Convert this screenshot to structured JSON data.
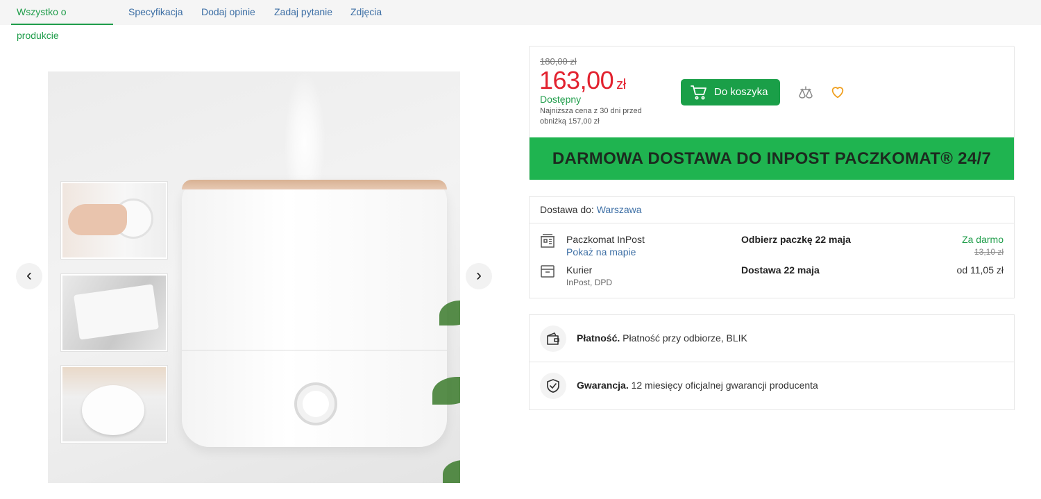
{
  "tabs": [
    {
      "label": "Wszystko o produkcie"
    },
    {
      "label": "Specyfikacja"
    },
    {
      "label": "Dodaj opinie"
    },
    {
      "label": "Zadaj pytanie"
    },
    {
      "label": "Zdjęcia"
    }
  ],
  "gallery": {
    "prev_symbol": "‹",
    "next_symbol": "›"
  },
  "pricing": {
    "old_price": "180,00 zł",
    "price": "163,00",
    "currency": "zł",
    "availability": "Dostępny",
    "lowest_price_note": "Najniższa cena z 30 dni przed obniżką 157,00 zł",
    "add_to_cart": "Do koszyka",
    "banner": "DARMOWA DOSTAWA DO INPOST PACZKOMAT® 24/7"
  },
  "delivery": {
    "dest_label": "Dostawa do:",
    "dest_city": "Warszawa",
    "options": [
      {
        "name": "Paczkomat InPost",
        "sub": "Pokaż na mapie",
        "date": "Odbierz paczkę 22 maja",
        "price": "Za darmo",
        "old_price": "13,10 zł"
      },
      {
        "name": "Kurier",
        "sub": "InPost, DPD",
        "date": "Dostawa 22 maja",
        "price": "od 11,05 zł"
      }
    ]
  },
  "info": {
    "payment_label": "Płatność.",
    "payment_text": "Płatność przy odbiorze, BLIK",
    "warranty_label": "Gwarancja.",
    "warranty_text": "12 miesięcy oficjalnej gwarancji producenta"
  },
  "colors": {
    "accent_green": "#1a9f48",
    "price_red": "#e2222f",
    "link_blue": "#3d6fa5",
    "heart_orange": "#f0a020"
  }
}
